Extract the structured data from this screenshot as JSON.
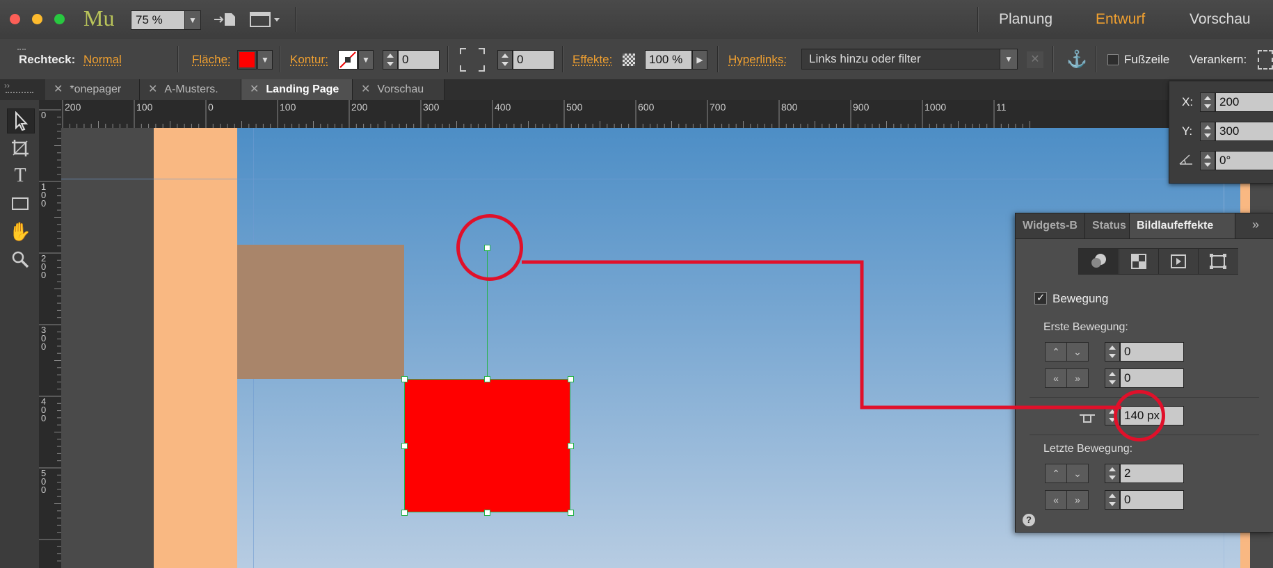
{
  "app": {
    "logo": "Mu",
    "zoom": "75 %"
  },
  "workspaces": {
    "planning": "Planung",
    "design": "Entwurf",
    "preview": "Vorschau",
    "active": "Entwurf"
  },
  "control_bar": {
    "object_label": "Rechteck:",
    "object_style": "Normal",
    "fill_label": "Fläche:",
    "fill_color": "#ff0000",
    "stroke_label": "Kontur:",
    "stroke_width": "0",
    "corner_radius": "0",
    "effects_label": "Effekte:",
    "opacity": "100 %",
    "hyperlinks_label": "Hyperlinks:",
    "hyperlinks_placeholder": "Links hinzu oder filter",
    "footer_label": "Fußzeile",
    "anchor_label": "Verankern:"
  },
  "tabs": [
    {
      "label": "*onepager",
      "active": false
    },
    {
      "label": "A-Musters.",
      "active": false
    },
    {
      "label": "Landing Page",
      "active": true
    },
    {
      "label": "Vorschau",
      "active": false
    }
  ],
  "tools": [
    "selection-tool",
    "crop-tool",
    "text-tool",
    "rectangle-tool",
    "hand-tool",
    "zoom-tool"
  ],
  "ruler": {
    "h_labels": [
      "200",
      "100",
      "0",
      "100",
      "200",
      "300",
      "400",
      "500",
      "600",
      "700",
      "800",
      "900",
      "1000",
      "11"
    ],
    "v_labels": [
      "0",
      "100",
      "200",
      "300",
      "400",
      "500"
    ]
  },
  "transform": {
    "x_label": "X:",
    "x_value": "200",
    "y_label": "Y:",
    "y_value": "300",
    "rotation": "0°"
  },
  "scroll_panel": {
    "tabs": [
      "Widgets-B",
      "Status",
      "Bildlaufeffekte"
    ],
    "active_tab": "Bildlaufeffekte",
    "motion_checkbox_label": "Bewegung",
    "motion_checked": true,
    "first_motion_label": "Erste Bewegung:",
    "first_vertical": "0",
    "first_horizontal": "0",
    "key_position": "140 px",
    "last_motion_label": "Letzte Bewegung:",
    "last_vertical": "2",
    "last_horizontal": "0",
    "help": "?"
  },
  "colors": {
    "accent": "#f0a030",
    "selected_rect": "#ff0000",
    "side_band": "#f9b882",
    "brown_box": "#a9856a",
    "annotation": "#e0102a"
  }
}
